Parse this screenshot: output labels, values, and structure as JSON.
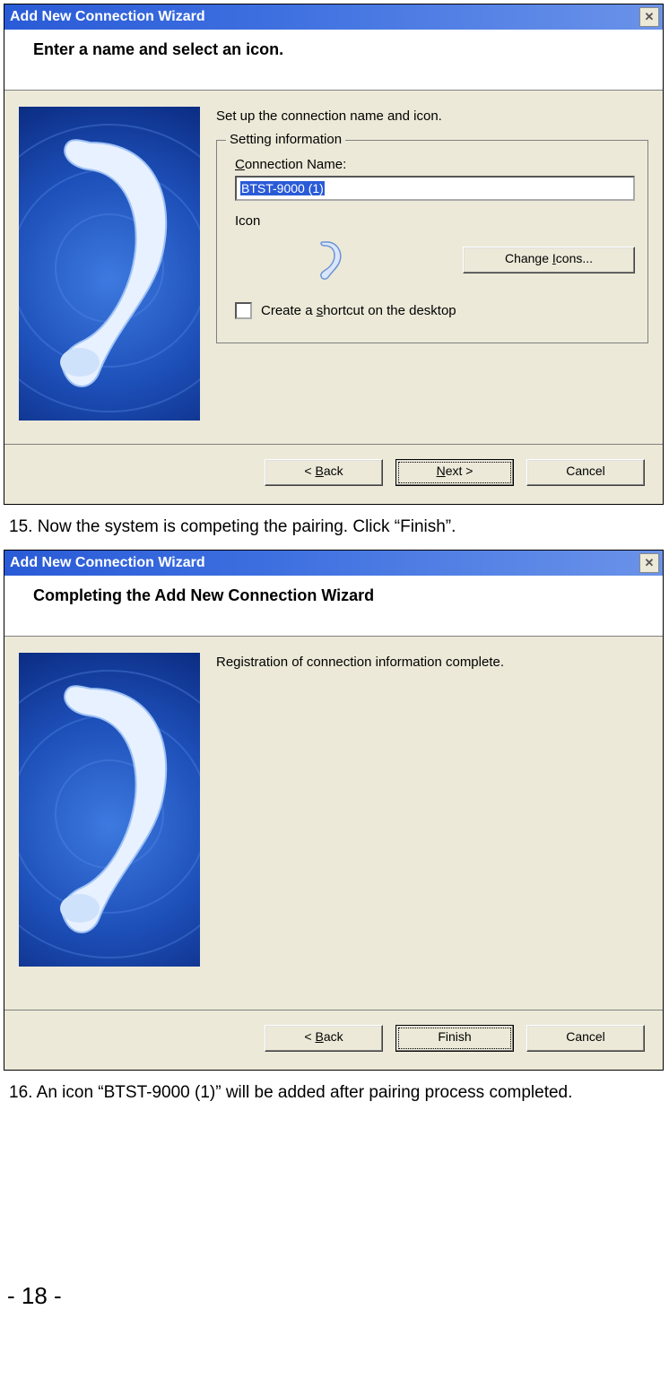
{
  "wizard1": {
    "title": "Add New Connection Wizard",
    "header": "Enter a name and select an icon.",
    "intro": "Set up the connection name and icon.",
    "group_legend": "Setting information",
    "conn_label_pre": "C",
    "conn_label_post": "onnection Name:",
    "conn_value": "BTST-9000 (1)",
    "icon_label": "Icon",
    "change_icons_pre": "Change ",
    "change_icons_under": "I",
    "change_icons_post": "cons...",
    "shortcut_pre": "Create a ",
    "shortcut_under": "s",
    "shortcut_post": "hortcut on the desktop",
    "back_pre": "< ",
    "back_under": "B",
    "back_post": "ack",
    "next_under": "N",
    "next_post": "ext >",
    "cancel": "Cancel"
  },
  "step15": "15.  Now the system is competing the pairing. Click “Finish”.",
  "wizard2": {
    "title": "Add New Connection Wizard",
    "header": "Completing the Add New Connection Wizard",
    "intro": "Registration of connection information complete.",
    "back_pre": "< ",
    "back_under": "B",
    "back_post": "ack",
    "finish": "Finish",
    "cancel": "Cancel"
  },
  "step16": "16.  An icon “BTST-9000 (1)” will be added after pairing process completed.",
  "page_number": "- 18 -"
}
